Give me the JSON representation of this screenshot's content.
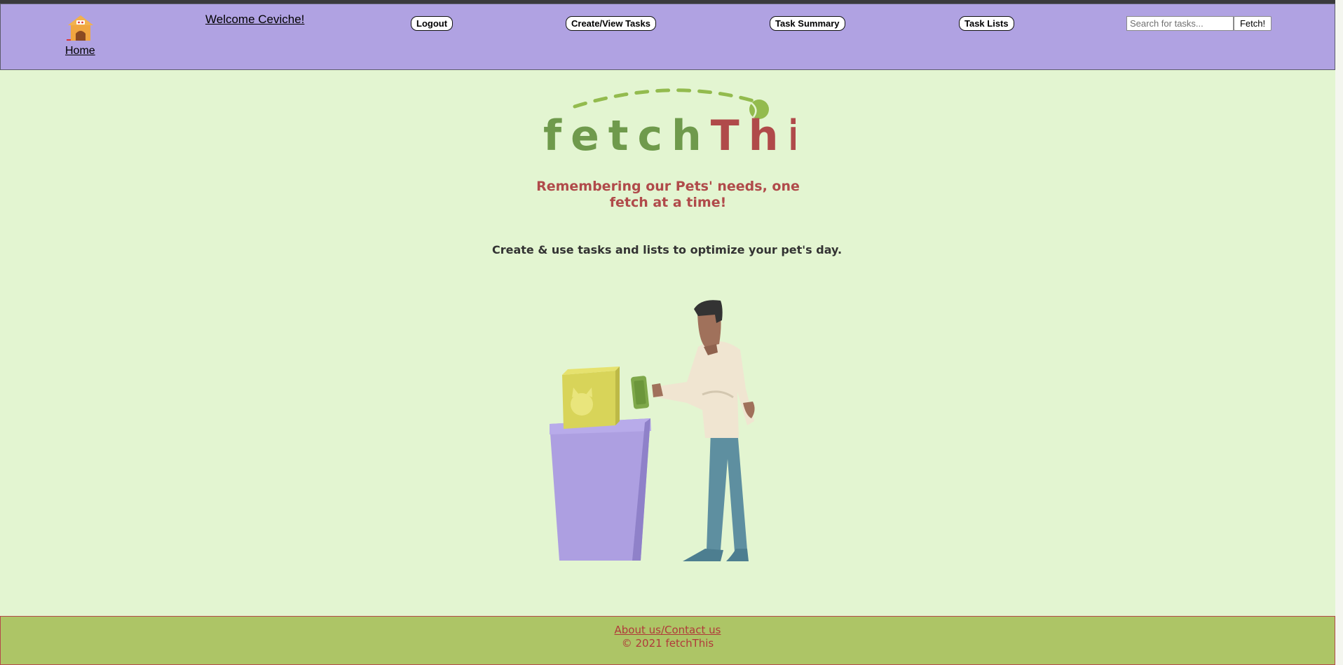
{
  "header": {
    "home_label": "Home",
    "home_icon": "doghouse-icon",
    "welcome_text": "Welcome Ceviche!",
    "nav": {
      "logout": "Logout",
      "create_view_tasks": "Create/View Tasks",
      "task_summary": "Task Summary",
      "task_lists": "Task Lists"
    },
    "search": {
      "placeholder": "Search for tasks...",
      "button_label": "Fetch!"
    }
  },
  "main": {
    "logo_part1": "fetch",
    "logo_part2": "This",
    "tagline": "Remembering our Pets' needs, one fetch at a time!",
    "intro": "Create & use tasks and lists to optimize your pet's day.",
    "illustration": "person-buying-pet-food-illustration"
  },
  "footer": {
    "about_contact": "About us/Contact us",
    "copyright": "© 2021 fetchThis"
  },
  "colors": {
    "page_background": "#e3f5d1",
    "navbar_background": "#b0a2e2",
    "footer_background": "#adc566",
    "brand_green": "#6f9a4c",
    "brand_red": "#b04a4a"
  }
}
